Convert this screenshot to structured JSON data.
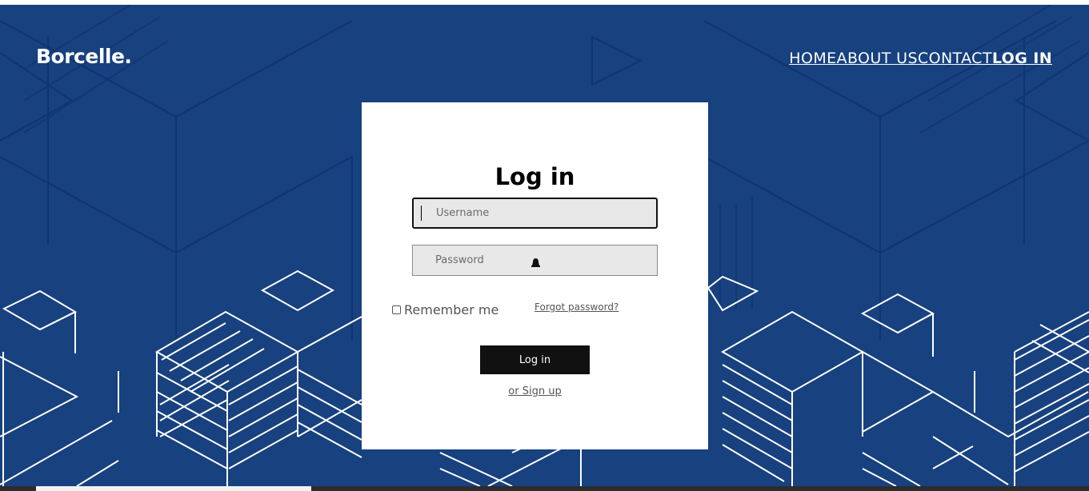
{
  "brand": {
    "logo_text": "Borcelle."
  },
  "nav": {
    "items": [
      {
        "label": "HOME"
      },
      {
        "label": "ABOUT US"
      },
      {
        "label": "CONTACT"
      },
      {
        "label": "LOG IN"
      }
    ]
  },
  "login": {
    "title": "Log in",
    "username_placeholder": "Username",
    "password_placeholder": "Password",
    "remember_label": "Remember me",
    "forgot_label": "Forgot password?",
    "submit_label": "Log in",
    "signup_label": "or Sign up"
  },
  "colors": {
    "hero_background": "#17417f",
    "pattern_lines": "#ffffff",
    "button_background": "#111111",
    "field_background": "#e8e8e8"
  },
  "icons": {
    "password_field_icon": "lock-icon"
  }
}
